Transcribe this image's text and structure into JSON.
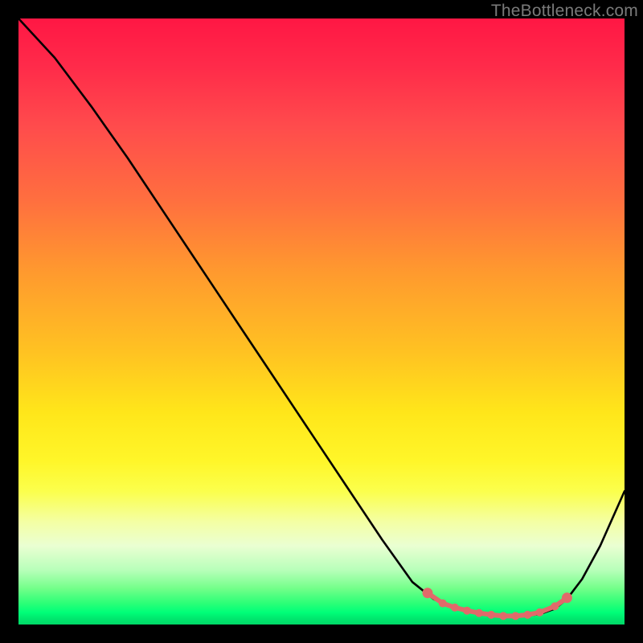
{
  "watermark": "TheBottleneck.com",
  "chart_data": {
    "type": "line",
    "title": "",
    "xlabel": "",
    "ylabel": "",
    "xlim": [
      0,
      100
    ],
    "ylim": [
      0,
      100
    ],
    "grid": false,
    "series": [
      {
        "name": "bottleneck-curve",
        "color": "#000000",
        "x": [
          0,
          6,
          12,
          18,
          24,
          30,
          36,
          42,
          48,
          54,
          60,
          65,
          68.5,
          71,
          74,
          77,
          80,
          83,
          86,
          88.5,
          90.5,
          93,
          96,
          100
        ],
        "y": [
          100,
          93.5,
          85.5,
          77,
          68,
          59,
          50,
          41,
          32,
          23,
          14,
          7,
          4.2,
          3.0,
          2.2,
          1.7,
          1.4,
          1.4,
          1.7,
          2.6,
          4.2,
          7.5,
          13,
          22
        ]
      },
      {
        "name": "trough-dots",
        "color": "#e06a6a",
        "shape": "dot",
        "x": [
          67.5,
          70,
          72,
          74,
          76,
          78,
          80,
          82,
          84,
          86,
          88.5,
          90.5
        ],
        "y": [
          5.2,
          3.5,
          2.8,
          2.3,
          1.9,
          1.6,
          1.4,
          1.4,
          1.6,
          2.0,
          3.0,
          4.4
        ]
      }
    ],
    "background_gradient": {
      "top": "#ff1744",
      "mid": "#ffe61a",
      "bottom": "#00d867"
    }
  }
}
